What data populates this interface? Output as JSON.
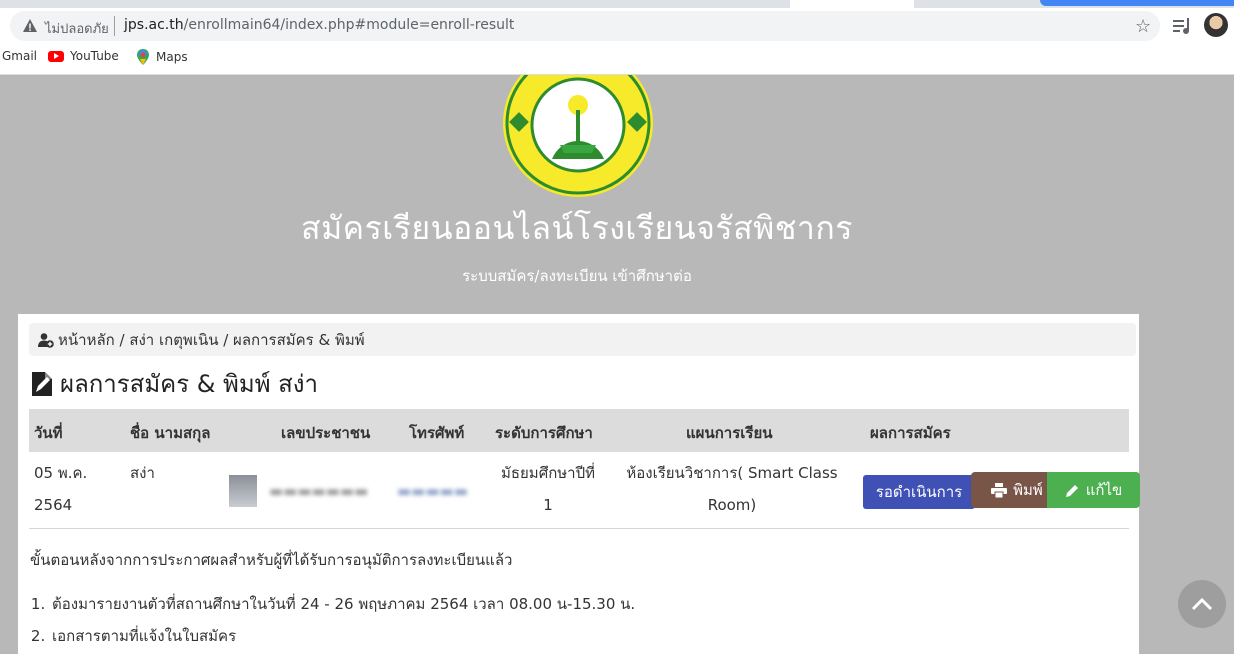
{
  "browser": {
    "not_secure_label": "ไม่ปลอดภัย",
    "url_host": "jps.ac.th",
    "url_path": "/enrollmain64/index.php#module=enroll-result",
    "bookmarks": [
      "Gmail",
      "YouTube",
      "Maps"
    ]
  },
  "hero": {
    "title": "สมัครเรียนออนไลน์โรงเรียนจรัสพิชากร",
    "subtitle": "ระบบสมัคร/ลงทะเบียน เข้าศึกษาต่อ"
  },
  "breadcrumb": {
    "text": "หน้าหลัก / สง่า เกตุพเนิน / ผลการสมัคร & พิมพ์"
  },
  "section_title": "ผลการสมัคร & พิมพ์ สง่า",
  "table": {
    "headers": [
      "วันที่",
      "ชื่อ นามสกุล",
      "เลขประชาชน",
      "โทรศัพท์",
      "ระดับการศึกษา",
      "แผนการเรียน",
      "ผลการสมัคร"
    ],
    "row": {
      "date_line1": "05 พ.ค.",
      "date_line2": "2564",
      "name_line1": "สง่า",
      "level_line1": "มัธยมศึกษาปีที่",
      "level_line2": "1",
      "plan_line1": "ห้องเรียนวิชาการ( Smart Class",
      "plan_line2": "Room)",
      "status_label": "รอดำเนินการ",
      "print_label": "พิมพ์",
      "edit_label": "แก้ไข"
    }
  },
  "steps": {
    "intro": "ขั้นตอนหลังจากการประกาศผลสำหรับผู้ที่ได้รับการอนุมัติการลงทะเบียนแล้ว",
    "items": [
      "ต้องมารายงานตัวที่สถานศึกษาในวันที่ 24 - 26 พฤษภาคม 2564 เวลา 08.00 น-15.30 น.",
      "เอกสารตามที่แจ้งในใบสมัคร"
    ]
  },
  "colors": {
    "page_bg": "#b8b8b8",
    "status_button": "#3f51b5",
    "print_button": "#795548",
    "edit_button": "#4caf50"
  },
  "icons": [
    "warning-icon",
    "star-icon",
    "media-control-icon",
    "user-plus-icon",
    "document-edit-icon",
    "print-icon",
    "pencil-icon",
    "chevron-up-icon"
  ]
}
